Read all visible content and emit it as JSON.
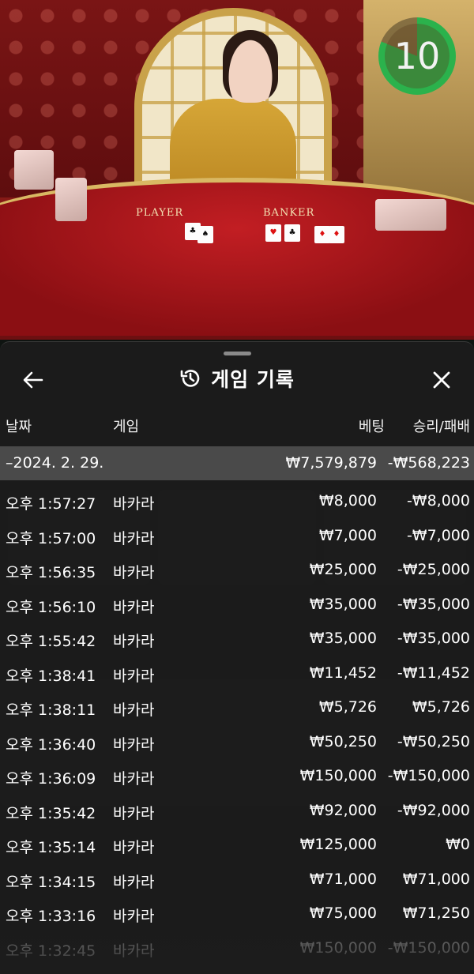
{
  "video": {
    "timer": "10",
    "player_label": "PLAYER",
    "banker_label": "BANKER"
  },
  "history": {
    "title": "게임 기록",
    "icons": {
      "back": "arrow-left-icon",
      "title": "history-clock-icon",
      "close": "close-icon"
    },
    "columns": {
      "date": "날짜",
      "game": "게임",
      "bet": "베팅",
      "result": "승리/패배"
    },
    "date_group": {
      "date": "–2024. 2. 29.",
      "total_bet": "₩7,579,879",
      "total_result": "-₩568,223"
    },
    "rows": [
      {
        "time": "오후 1:57:27",
        "game": "바카라",
        "bet": "₩8,000",
        "result": "-₩8,000"
      },
      {
        "time": "오후 1:57:00",
        "game": "바카라",
        "bet": "₩7,000",
        "result": "-₩7,000"
      },
      {
        "time": "오후 1:56:35",
        "game": "바카라",
        "bet": "₩25,000",
        "result": "-₩25,000"
      },
      {
        "time": "오후 1:56:10",
        "game": "바카라",
        "bet": "₩35,000",
        "result": "-₩35,000"
      },
      {
        "time": "오후 1:55:42",
        "game": "바카라",
        "bet": "₩35,000",
        "result": "-₩35,000"
      },
      {
        "time": "오후 1:38:41",
        "game": "바카라",
        "bet": "₩11,452",
        "result": "-₩11,452"
      },
      {
        "time": "오후 1:38:11",
        "game": "바카라",
        "bet": "₩5,726",
        "result": "₩5,726"
      },
      {
        "time": "오후 1:36:40",
        "game": "바카라",
        "bet": "₩50,250",
        "result": "-₩50,250"
      },
      {
        "time": "오후 1:36:09",
        "game": "바카라",
        "bet": "₩150,000",
        "result": "-₩150,000"
      },
      {
        "time": "오후 1:35:42",
        "game": "바카라",
        "bet": "₩92,000",
        "result": "-₩92,000"
      },
      {
        "time": "오후 1:35:14",
        "game": "바카라",
        "bet": "₩125,000",
        "result": "₩0"
      },
      {
        "time": "오후 1:34:15",
        "game": "바카라",
        "bet": "₩71,000",
        "result": "₩71,000"
      },
      {
        "time": "오후 1:33:16",
        "game": "바카라",
        "bet": "₩75,000",
        "result": "₩71,250"
      },
      {
        "time": "오후 1:32:45",
        "game": "바카라",
        "bet": "₩150,000",
        "result": "-₩150,000"
      }
    ]
  }
}
